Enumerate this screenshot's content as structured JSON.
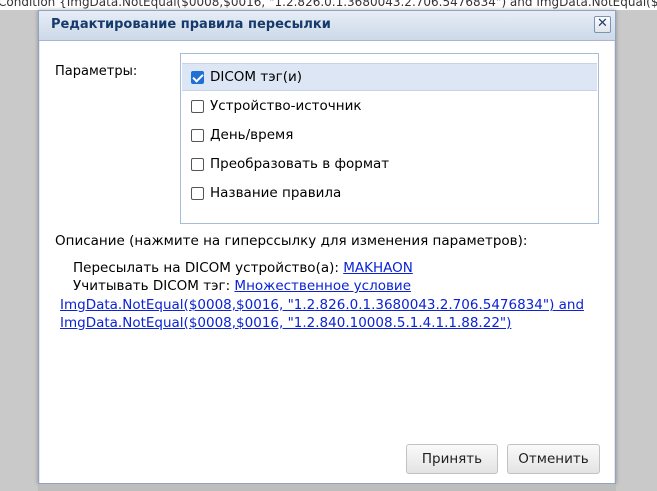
{
  "background": {
    "text": "Condition {ImgData.NotEqual($0008,$0016, \"1.2.826.0.1.3680043.2.706.5476834\") and ImgData.NotEqual($"
  },
  "dialog": {
    "title": "Редактирование правила пересылки",
    "close_glyph": "✕",
    "params_label": "Параметры:",
    "params": [
      {
        "label": "DICOM тэг(и)",
        "checked": true,
        "selected": true
      },
      {
        "label": "Устройство-источник",
        "checked": false,
        "selected": false
      },
      {
        "label": "День/время",
        "checked": false,
        "selected": false
      },
      {
        "label": "Преобразовать в формат",
        "checked": false,
        "selected": false
      },
      {
        "label": "Название правила",
        "checked": false,
        "selected": false
      }
    ],
    "description_label": "Описание (нажмите на гиперссылку для изменения параметров):",
    "description": {
      "forward_prefix": "Пересылать на DICOM устройство(а): ",
      "forward_link": "MAKHAON",
      "tag_prefix": "Учитывать DICOM тэг: ",
      "tag_link_line1": "Множественное условие",
      "tag_link_line2": "ImgData.NotEqual($0008,$0016, \"1.2.826.0.1.3680043.2.706.5476834\") and",
      "tag_link_line3": "ImgData.NotEqual($0008,$0016, \"1.2.840.10008.5.1.4.1.1.88.22\")"
    },
    "buttons": {
      "accept": "Принять",
      "cancel": "Отменить"
    }
  },
  "colors": {
    "title_text": "#163a6b",
    "link": "#0b23d4",
    "checkbox_checked": "#1f6fd6"
  }
}
